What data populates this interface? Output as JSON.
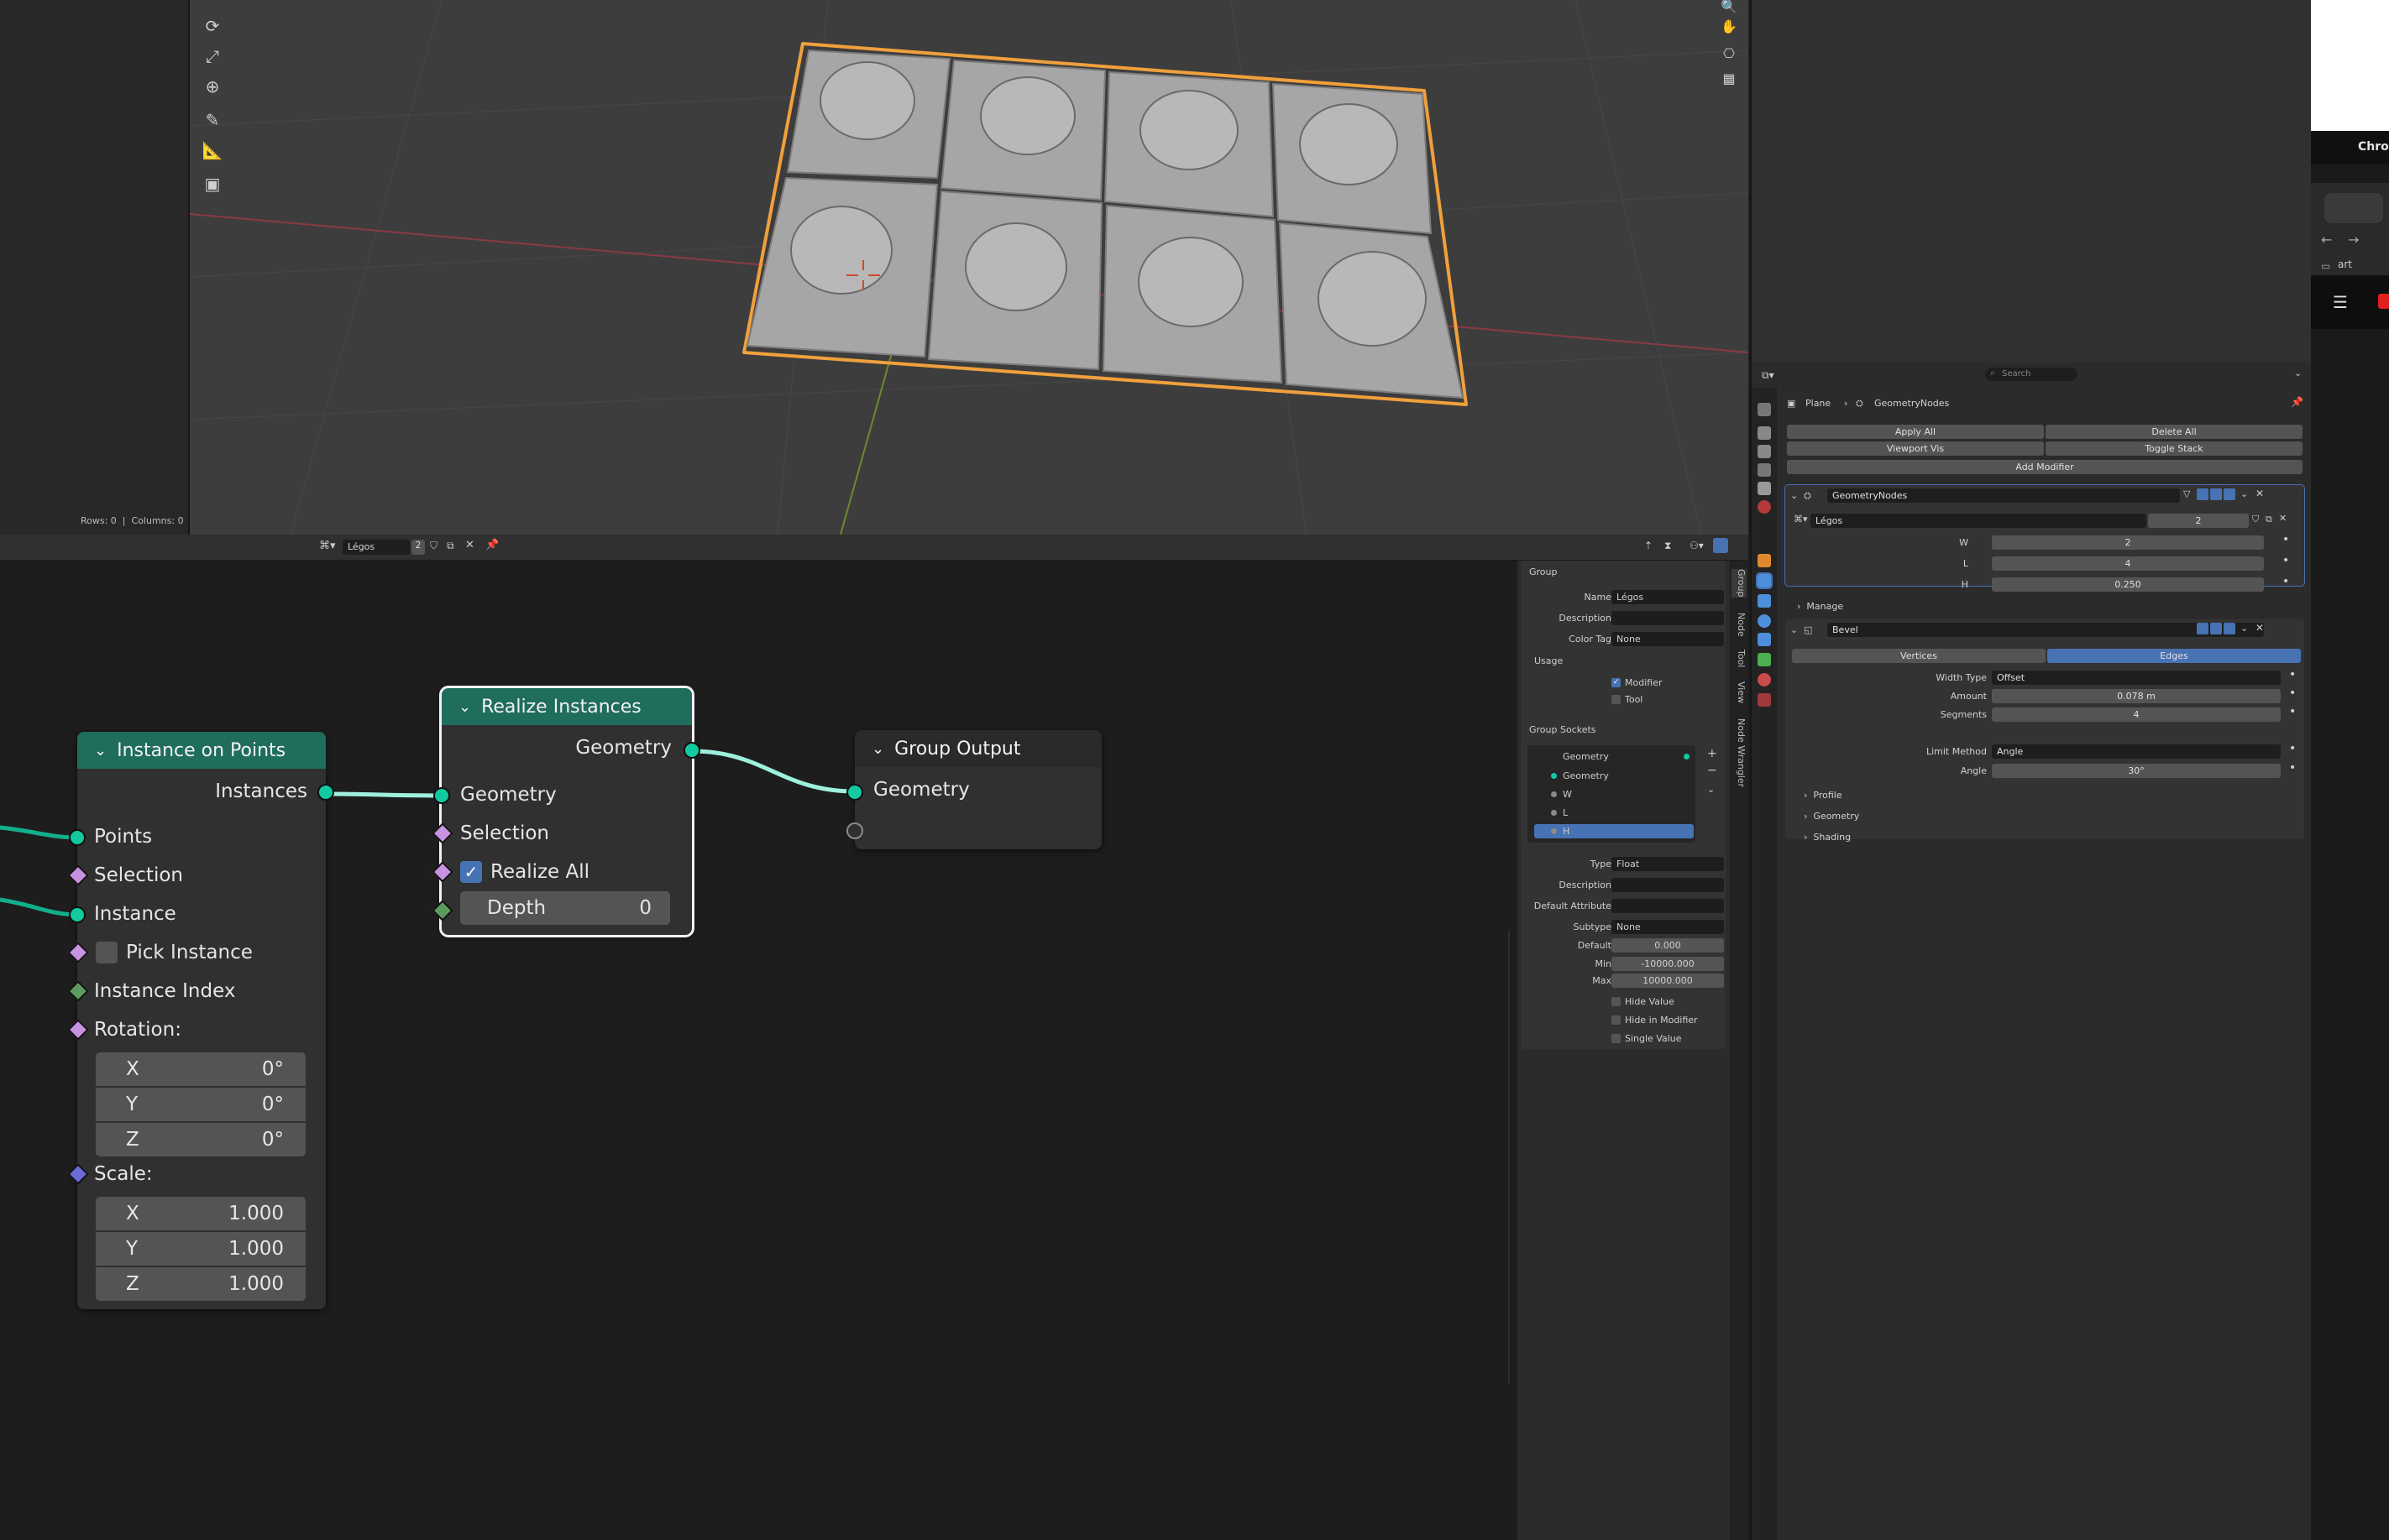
{
  "viewport": {
    "status_rows": "Rows: 0",
    "status_columns": "Columns: 0"
  },
  "node_editor": {
    "header": {
      "tree_name": "Légos",
      "users": "2"
    },
    "instance_on_points": {
      "title": "Instance on Points",
      "output": "Instances",
      "inputs": [
        "Points",
        "Selection",
        "Instance",
        "Pick Instance",
        "Instance Index",
        "Rotation:",
        "Scale:"
      ],
      "rotation": [
        {
          "axis": "X",
          "value": "0°"
        },
        {
          "axis": "Y",
          "value": "0°"
        },
        {
          "axis": "Z",
          "value": "0°"
        }
      ],
      "scale": [
        {
          "axis": "X",
          "value": "1.000"
        },
        {
          "axis": "Y",
          "value": "1.000"
        },
        {
          "axis": "Z",
          "value": "1.000"
        }
      ]
    },
    "realize_instances": {
      "title": "Realize Instances",
      "output": "Geometry",
      "input_geometry": "Geometry",
      "input_selection": "Selection",
      "realize_all": "Realize All",
      "depth_label": "Depth",
      "depth_value": "0"
    },
    "group_output": {
      "title": "Group Output",
      "input": "Geometry"
    }
  },
  "n_panel": {
    "tabs": [
      "Group",
      "Node",
      "Tool",
      "View",
      "Node Wrangler"
    ],
    "group_title": "Group",
    "name_label": "Name",
    "name_value": "Légos",
    "description_label": "Description",
    "color_tag_label": "Color Tag",
    "color_tag_value": "None",
    "usage_title": "Usage",
    "usage_modifier": "Modifier",
    "usage_tool": "Tool",
    "sockets_title": "Group Sockets",
    "sockets": [
      "Geometry",
      "Geometry",
      "W",
      "L",
      "H"
    ],
    "type_label": "Type",
    "type_value": "Float",
    "desc_label": "Description",
    "default_attr_label": "Default Attribute",
    "subtype_label": "Subtype",
    "subtype_value": "None",
    "default_label": "Default",
    "default_value": "0.000",
    "min_label": "Min",
    "min_value": "-10000.000",
    "max_label": "Max",
    "max_value": "10000.000",
    "hide_value": "Hide Value",
    "hide_in_modifier": "Hide in Modifier",
    "single_value": "Single Value"
  },
  "properties": {
    "search_placeholder": "Search",
    "breadcrumb_object": "Plane",
    "breadcrumb_modifier": "GeometryNodes",
    "apply_all": "Apply All",
    "delete_all": "Delete All",
    "viewport_vis": "Viewport Vis",
    "toggle_stack": "Toggle Stack",
    "add_modifier": "Add Modifier",
    "gn_modifier_name": "GeometryNodes",
    "gn_tree": "Légos",
    "gn_users": "2",
    "inputs": [
      {
        "label": "W",
        "value": "2"
      },
      {
        "label": "L",
        "value": "4"
      },
      {
        "label": "H",
        "value": "0.250"
      }
    ],
    "manage": "Manage",
    "bevel_name": "Bevel",
    "bevel_tab_vertices": "Vertices",
    "bevel_tab_edges": "Edges",
    "width_type_label": "Width Type",
    "width_type_value": "Offset",
    "amount_label": "Amount",
    "amount_value": "0.078 m",
    "segments_label": "Segments",
    "segments_value": "4",
    "limit_method_label": "Limit Method",
    "limit_method_value": "Angle",
    "angle_label": "Angle",
    "angle_value": "30°",
    "subpanels": [
      "Profile",
      "Geometry",
      "Shading"
    ]
  },
  "chrome": {
    "app_label": "Chron",
    "bookmark": "art"
  },
  "colors": {
    "node_header": "#1f6d5d",
    "geometry_socket": "#12c9a0",
    "field_socket": "#c792e0",
    "int_socket": "#5d9a5d",
    "selection_outline": "#f0a03c",
    "active_blue": "#4772b3"
  }
}
